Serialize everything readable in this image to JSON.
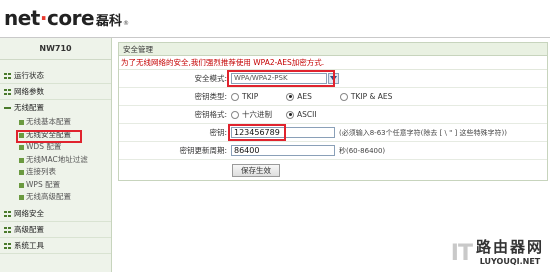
{
  "header": {
    "logo_main": "net",
    "logo_dot": "·",
    "logo_main2": "core",
    "logo_cn": "磊科",
    "logo_reg": "®"
  },
  "sidebar": {
    "model": "NW710",
    "items": [
      {
        "label": "运行状态"
      },
      {
        "label": "网络参数"
      },
      {
        "label": "无线配置"
      }
    ],
    "sub_items": [
      {
        "label": "无线基本配置"
      },
      {
        "label": "无线安全配置"
      },
      {
        "label": "WDS 配置"
      },
      {
        "label": "无线MAC地址过滤"
      },
      {
        "label": "连接列表"
      },
      {
        "label": "WPS 配置"
      },
      {
        "label": "无线高级配置"
      }
    ],
    "items_after": [
      {
        "label": "网络安全"
      },
      {
        "label": "高级配置"
      },
      {
        "label": "系统工具"
      }
    ]
  },
  "panel": {
    "title": "安全管理",
    "notice": "为了无线网络的安全,我们强烈推荐使用 WPA2-AES加密方式.",
    "security_mode_label": "安全模式:",
    "security_mode_value": "WPA/WPA2-PSK",
    "cipher_label": "密钥类型:",
    "cipher_options": [
      "TKIP",
      "AES",
      "TKIP & AES"
    ],
    "cipher_selected": 1,
    "format_label": "密钥格式:",
    "format_options": [
      "十六进制",
      "ASCII"
    ],
    "format_selected": 1,
    "key_label": "密钥:",
    "key_value": "123456789",
    "key_hint": "(必须输入8-63个任意字符(除去 [ \\ \" ] 这些特殊字符))",
    "renew_label": "密钥更新周期:",
    "renew_value": "86400",
    "renew_hint": "秒(60-86400)",
    "save_button": "保存生效"
  },
  "watermark": {
    "it": "IT",
    "cn": "路由器网",
    "en": "LUYOUQI.NET"
  },
  "colors": {
    "highlight_red": "#e0232e",
    "notice_red": "#c40000",
    "sidebar_bg": "#eef3ea",
    "accent_green": "#4a7a2c"
  }
}
